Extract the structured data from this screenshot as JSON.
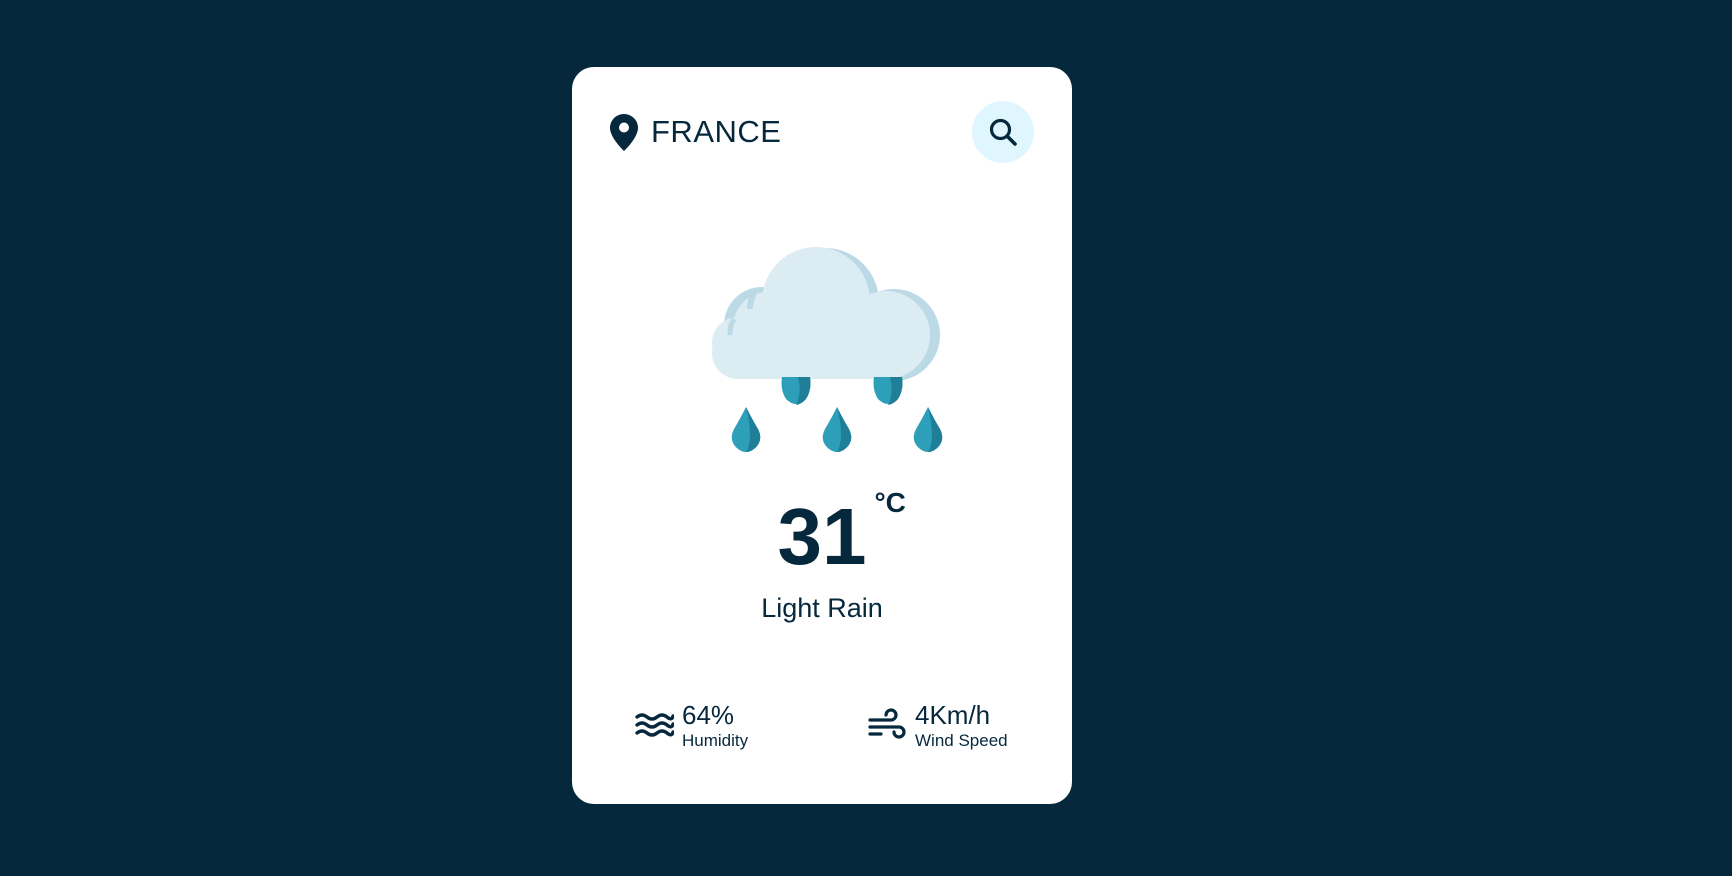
{
  "header": {
    "location": "FRANCE",
    "pin_icon": "location-pin-icon",
    "search_icon": "search-icon"
  },
  "weather": {
    "icon": "cloud-rain-icon",
    "temperature": "31",
    "unit": "°C",
    "condition": "Light Rain"
  },
  "details": {
    "humidity": {
      "value": "64%",
      "label": "Humidity",
      "icon": "water-waves-icon"
    },
    "wind": {
      "value": "4Km/h",
      "label": "Wind Speed",
      "icon": "wind-icon"
    }
  },
  "colors": {
    "background": "#06283d",
    "card": "#ffffff",
    "text": "#06283d",
    "search_button_bg": "#dff6ff",
    "cloud": "#dbecf2",
    "cloud_shade": "#bcd9e6",
    "raindrop": "#2e9fb8",
    "raindrop_shade": "#1f7f99"
  }
}
